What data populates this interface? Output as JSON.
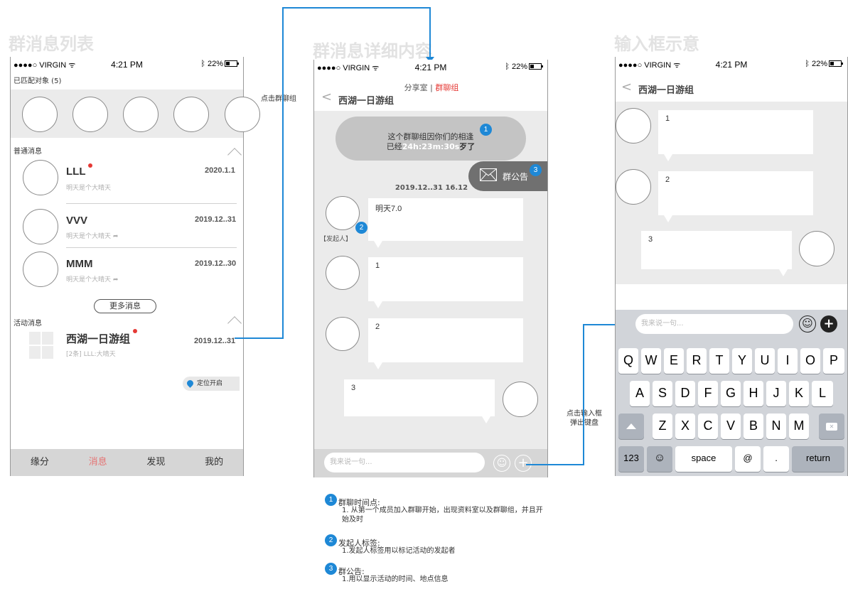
{
  "sections": {
    "list_title": "群消息列表",
    "detail_title": "群消息详细内容",
    "input_title": "输入框示意"
  },
  "statusbar": {
    "carrier": "●●●●○ VIRGIN ",
    "time": "4:21 PM",
    "battery": "22%"
  },
  "list": {
    "matched_label": "已匹配对象 (5)",
    "normal_header": "普通消息",
    "messages": [
      {
        "name": "LLL",
        "preview": "明天是个大晴天",
        "date": "2020.1.1"
      },
      {
        "name": "VVV",
        "preview": "明天是个大晴天",
        "date": "2019.12..31"
      },
      {
        "name": "MMM",
        "preview": "明天是个大晴天",
        "date": "2019.12..30"
      }
    ],
    "more_button": "更多消息",
    "activity_header": "活动消息",
    "activity": {
      "name": "西湖一日游组",
      "preview": "[2条] LLL:大晴天",
      "date": "2019.12..31"
    },
    "location_button": "定位开启",
    "tabs": [
      "缘分",
      "消息",
      "发现",
      "我的"
    ]
  },
  "annotations": {
    "tap_group": "点击群聊组",
    "tap_input_line1": "点击输入框",
    "tap_input_line2": "弹出键盘"
  },
  "detail": {
    "room_label": "分享室",
    "separator": " | ",
    "group_label": "群聊组",
    "back_title": "西湖一日游组",
    "banner_line1": "这个群聊组因你们的相逢",
    "banner_prefix": "已经",
    "banner_timer": "24h:23m:30s",
    "banner_suffix": "歹了",
    "notice_label": "群公告",
    "timestamp": "2019.12..31  16.12",
    "initiator_tag": "【发起人】",
    "msg_1": "明天7.0",
    "msg_2": "1",
    "msg_3": "2",
    "msg_4": "3",
    "input_placeholder": "我来说一句...",
    "badge_1": "1",
    "badge_2": "2",
    "badge_3": "3"
  },
  "input_demo": {
    "back_title": "西湖一日游组",
    "msg_1": "1",
    "msg_2": "2",
    "msg_3": "3",
    "input_placeholder": "我来说一句...",
    "keyboard": {
      "row1": [
        "Q",
        "W",
        "E",
        "R",
        "T",
        "Y",
        "U",
        "I",
        "O",
        "P"
      ],
      "row2": [
        "A",
        "S",
        "D",
        "F",
        "G",
        "H",
        "J",
        "K",
        "L"
      ],
      "row3": [
        "Z",
        "X",
        "C",
        "V",
        "B",
        "N",
        "M"
      ],
      "numbers": "123",
      "space": "space",
      "at": "@",
      "dot": ".",
      "return": "return"
    }
  },
  "notes": [
    {
      "badge": "1",
      "title": "群聊时间点:",
      "body": "1. 从第一个成员加入群聊开始，出现资料室以及群聊组，并且开始及时"
    },
    {
      "badge": "2",
      "title": "发起人标签:",
      "body": "1.发起人标签用以标记活动的发起者"
    },
    {
      "badge": "3",
      "title": "群公告:",
      "body": "1.用以显示活动的时间、地点信息"
    }
  ],
  "colors": {
    "accent_blue": "#1e88d6",
    "accent_red": "#e53935",
    "tab_active": "#e57373"
  }
}
